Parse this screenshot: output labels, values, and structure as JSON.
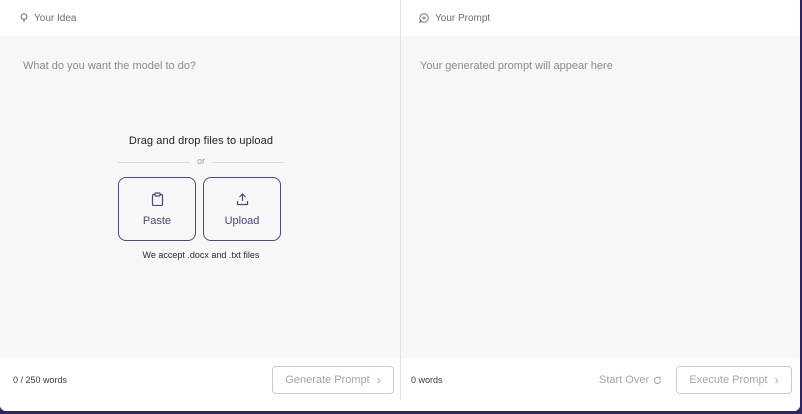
{
  "left_panel": {
    "header_label": "Your Idea",
    "header_icon": "lightbulb-icon",
    "input_placeholder": "What do you want the model to do?",
    "dropzone": {
      "title": "Drag and drop files to upload",
      "separator": "or",
      "paste_label": "Paste",
      "upload_label": "Upload",
      "accept_note": "We accept .docx and .txt files"
    },
    "word_count": "0 / 250 words",
    "generate_label": "Generate Prompt"
  },
  "right_panel": {
    "header_label": "Your Prompt",
    "header_icon": "chat-plus-icon",
    "output_placeholder": "Your generated prompt will appear here",
    "word_count": "0 words",
    "start_over_label": "Start Over",
    "execute_label": "Execute Prompt"
  },
  "colors": {
    "frame_background": "#2f2560",
    "accent": "#4b487a",
    "muted_text": "#a4a4ab"
  }
}
